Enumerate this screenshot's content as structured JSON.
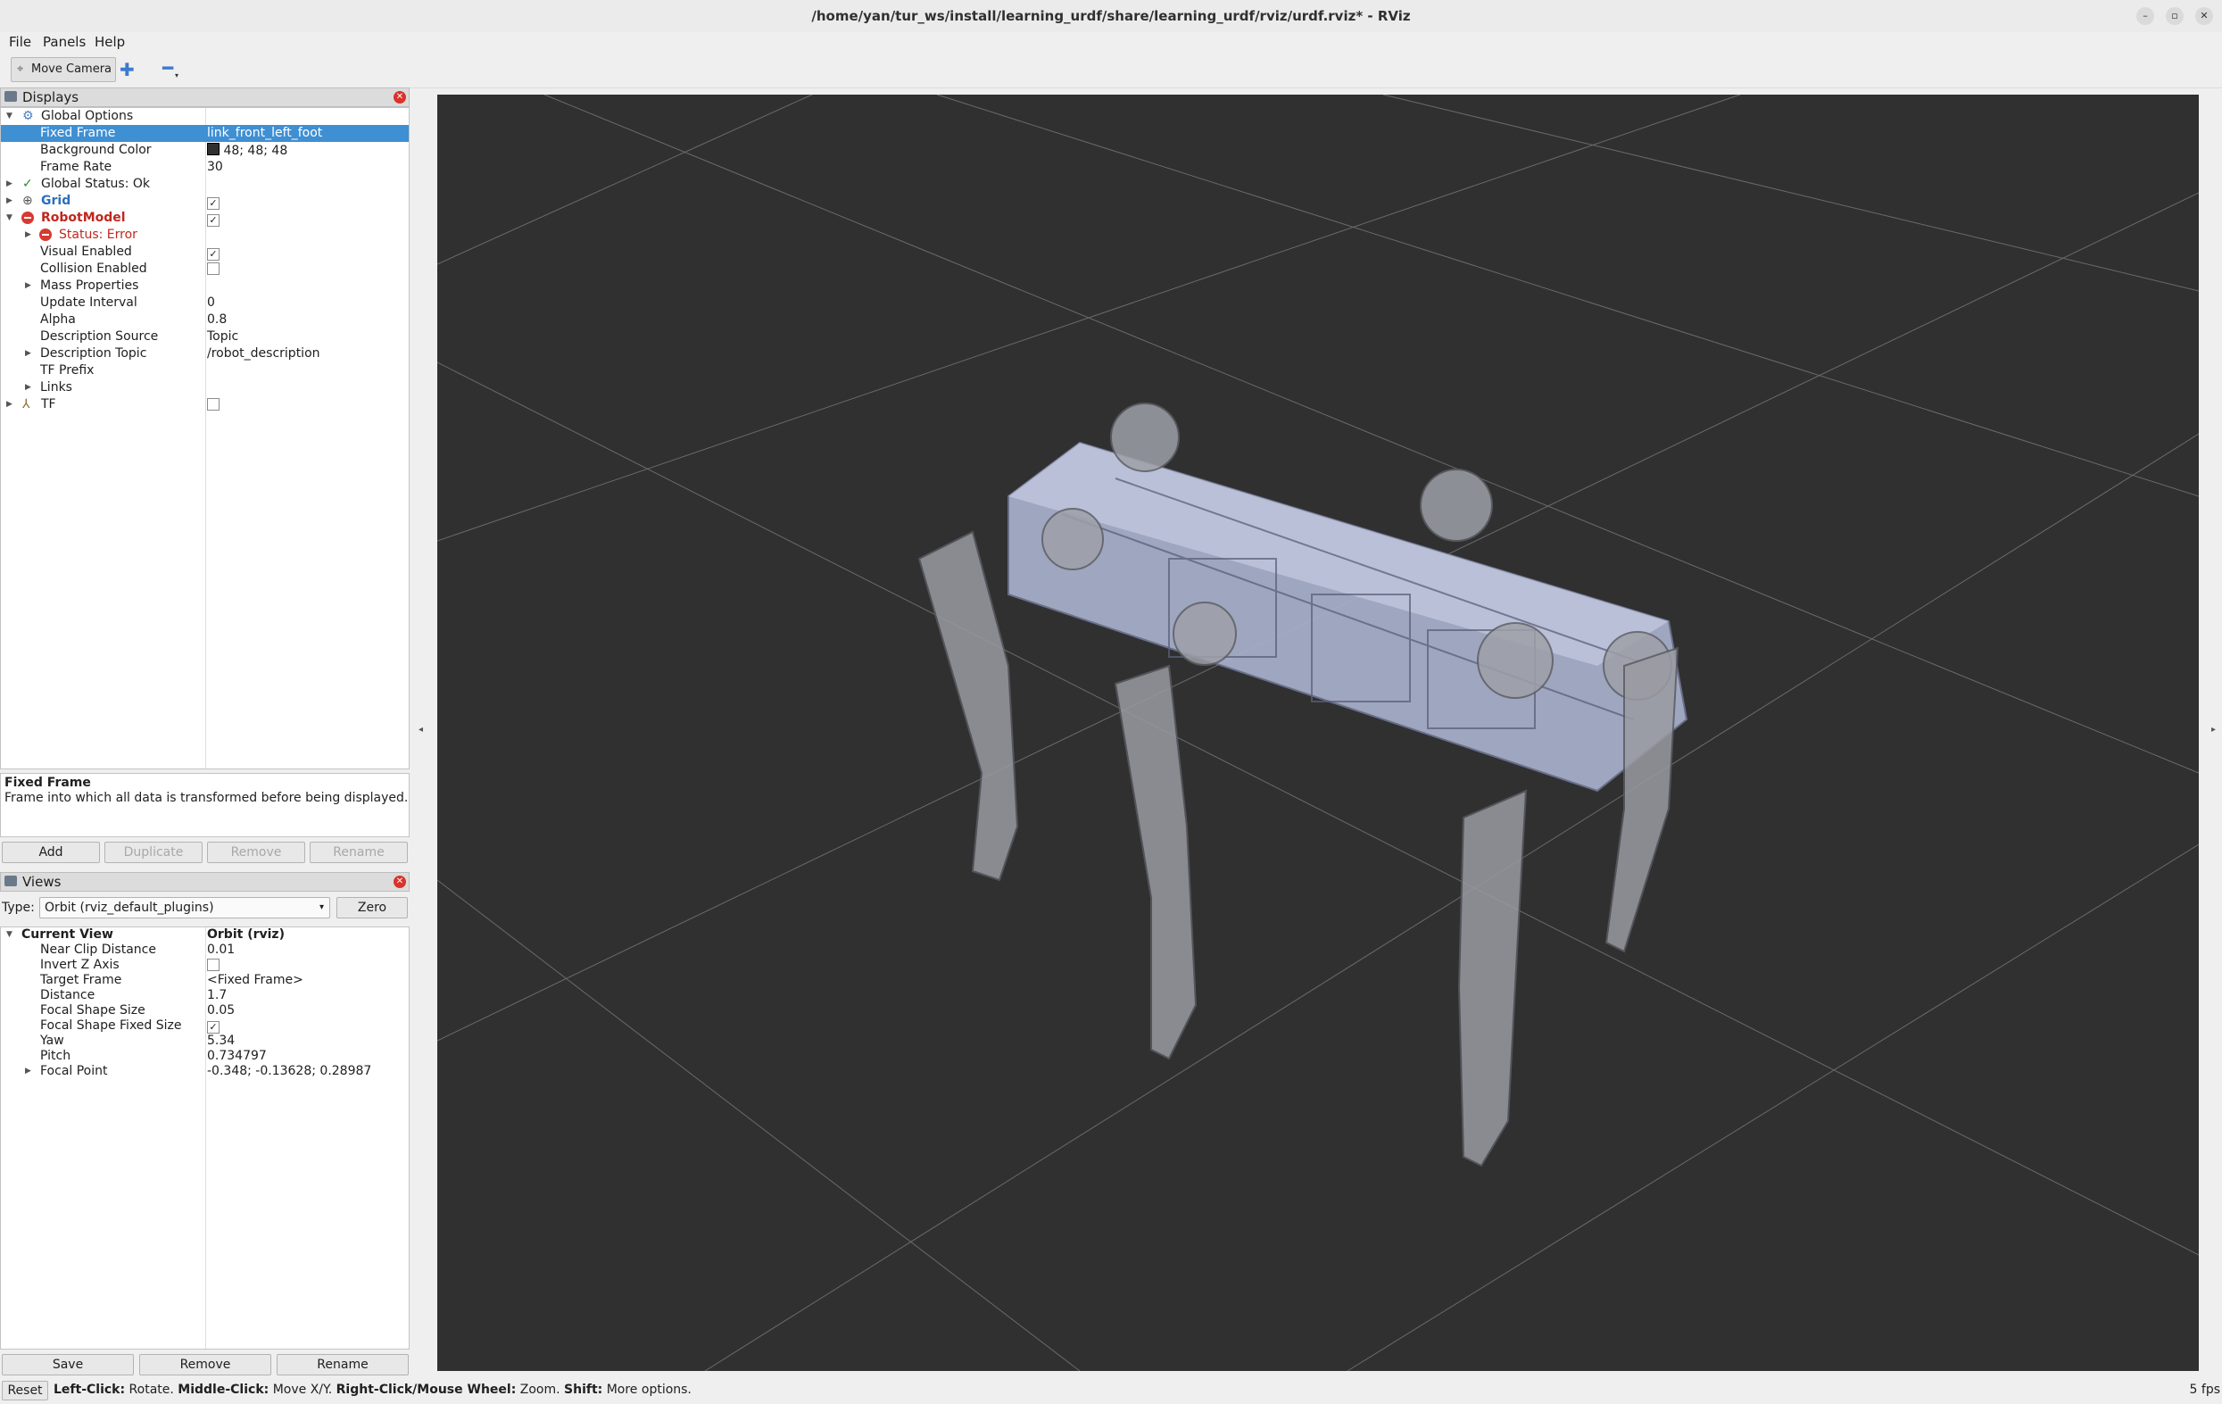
{
  "window": {
    "title": "/home/yan/tur_ws/install/learning_urdf/share/learning_urdf/rviz/urdf.rviz* - RViz"
  },
  "menu": [
    "File",
    "Panels",
    "Help"
  ],
  "toolbar": {
    "move_camera": "Move Camera"
  },
  "displays": {
    "title": "Displays",
    "rows": [
      {
        "label": "Global Options",
        "value": ""
      },
      {
        "label": "Fixed Frame",
        "value": "link_front_left_foot"
      },
      {
        "label": "Background Color",
        "value": "48; 48; 48"
      },
      {
        "label": "Frame Rate",
        "value": "30"
      },
      {
        "label": "Global Status: Ok",
        "value": ""
      },
      {
        "label": "Grid",
        "value": ""
      },
      {
        "label": "RobotModel",
        "value": ""
      },
      {
        "label": "Status: Error",
        "value": ""
      },
      {
        "label": "Visual Enabled",
        "value": ""
      },
      {
        "label": "Collision Enabled",
        "value": ""
      },
      {
        "label": "Mass Properties",
        "value": ""
      },
      {
        "label": "Update Interval",
        "value": "0"
      },
      {
        "label": "Alpha",
        "value": "0.8"
      },
      {
        "label": "Description Source",
        "value": "Topic"
      },
      {
        "label": "Description Topic",
        "value": "/robot_description"
      },
      {
        "label": "TF Prefix",
        "value": ""
      },
      {
        "label": "Links",
        "value": ""
      },
      {
        "label": "TF",
        "value": ""
      }
    ],
    "description_title": "Fixed Frame",
    "description_text": "Frame into which all data is transformed before being displayed.",
    "buttons": {
      "add": "Add",
      "duplicate": "Duplicate",
      "remove": "Remove",
      "rename": "Rename"
    },
    "background_swatch": "#303030"
  },
  "views": {
    "title": "Views",
    "type_label": "Type:",
    "type_value": "Orbit (rviz_default_plugins)",
    "zero": "Zero",
    "rows": [
      {
        "label": "Current View",
        "value": "Orbit (rviz)"
      },
      {
        "label": "Near Clip Distance",
        "value": "0.01"
      },
      {
        "label": "Invert Z Axis",
        "value": ""
      },
      {
        "label": "Target Frame",
        "value": "<Fixed Frame>"
      },
      {
        "label": "Distance",
        "value": "1.7"
      },
      {
        "label": "Focal Shape Size",
        "value": "0.05"
      },
      {
        "label": "Focal Shape Fixed Size",
        "value": ""
      },
      {
        "label": "Yaw",
        "value": "5.34"
      },
      {
        "label": "Pitch",
        "value": "0.734797"
      },
      {
        "label": "Focal Point",
        "value": "-0.348; -0.13628; 0.28987"
      }
    ],
    "buttons": {
      "save": "Save",
      "remove": "Remove",
      "rename": "Rename"
    }
  },
  "status": {
    "reset": "Reset",
    "b1": "Left-Click:",
    "t1": " Rotate. ",
    "b2": "Middle-Click:",
    "t2": " Move X/Y. ",
    "b3": "Right-Click/Mouse Wheel:",
    "t3": " Zoom. ",
    "b4": "Shift:",
    "t4": " More options.",
    "fps": "5 fps"
  },
  "colors": {
    "selection": "#3f8fd3",
    "error": "#d73a30",
    "grid_label": "#2a6fbd",
    "viewport_bg": "#303030"
  }
}
